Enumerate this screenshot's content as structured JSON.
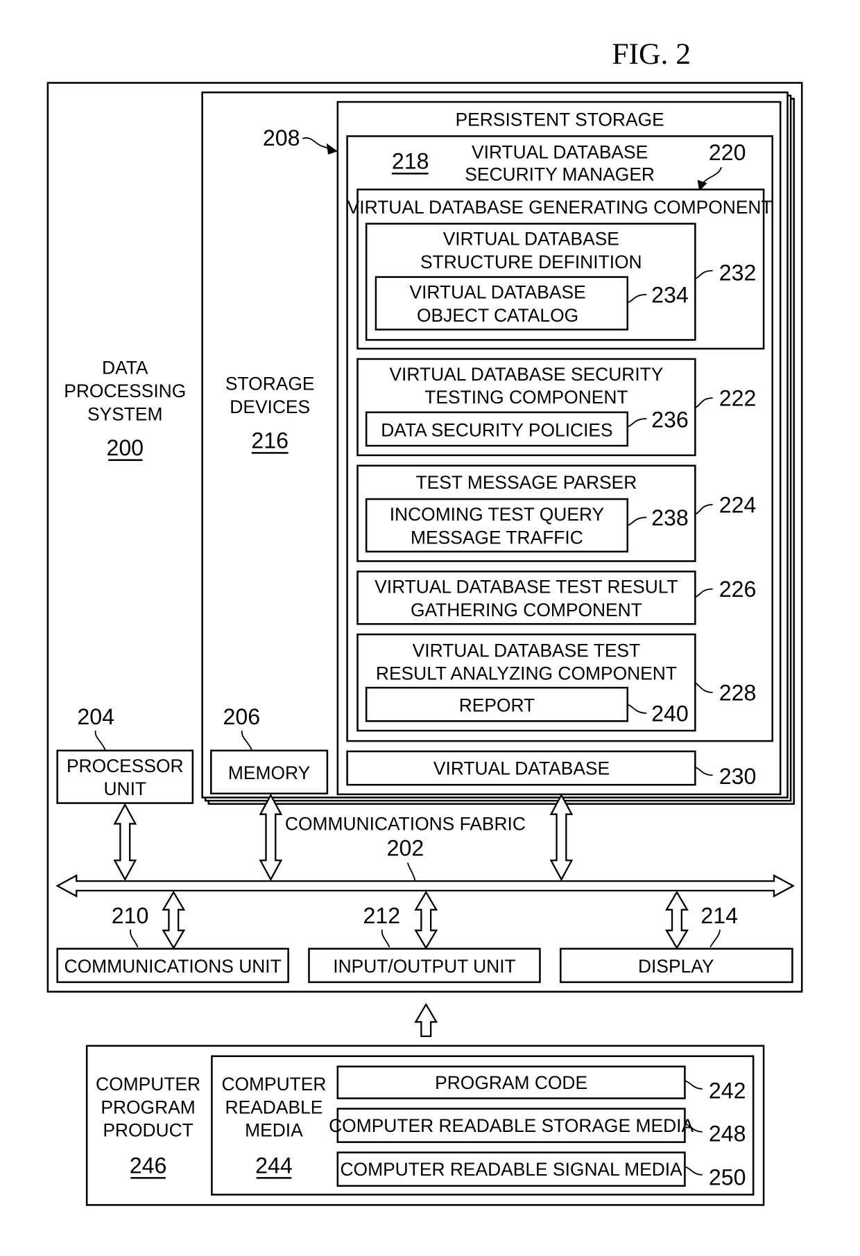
{
  "figure": {
    "title": "FIG. 2"
  },
  "data_processing_system": {
    "label_lines": [
      "DATA",
      "PROCESSING",
      "SYSTEM"
    ],
    "ref": "200"
  },
  "storage_devices": {
    "label_lines": [
      "STORAGE",
      "DEVICES"
    ],
    "ref": "216"
  },
  "persistent_storage": {
    "label": "PERSISTENT STORAGE",
    "ref": "208"
  },
  "security_manager": {
    "label_lines": [
      "VIRTUAL DATABASE",
      "SECURITY MANAGER"
    ],
    "ref": "218"
  },
  "generating_component": {
    "label": "VIRTUAL DATABASE GENERATING COMPONENT",
    "ref": "220"
  },
  "structure_definition": {
    "label_lines": [
      "VIRTUAL DATABASE",
      "STRUCTURE DEFINITION"
    ],
    "ref": "232"
  },
  "object_catalog": {
    "label_lines": [
      "VIRTUAL DATABASE",
      "OBJECT CATALOG"
    ],
    "ref": "234"
  },
  "security_testing": {
    "label_lines": [
      "VIRTUAL DATABASE SECURITY",
      "TESTING COMPONENT"
    ],
    "ref": "222"
  },
  "security_policies": {
    "label": "DATA SECURITY POLICIES",
    "ref": "236"
  },
  "message_parser": {
    "label": "TEST MESSAGE PARSER",
    "ref": "224"
  },
  "query_traffic": {
    "label_lines": [
      "INCOMING TEST QUERY",
      "MESSAGE TRAFFIC"
    ],
    "ref": "238"
  },
  "result_gathering": {
    "label_lines": [
      "VIRTUAL DATABASE TEST RESULT",
      "GATHERING COMPONENT"
    ],
    "ref": "226"
  },
  "result_analyzing": {
    "label_lines": [
      "VIRTUAL DATABASE TEST",
      "RESULT ANALYZING COMPONENT"
    ],
    "ref": "228"
  },
  "report": {
    "label": "REPORT",
    "ref": "240"
  },
  "virtual_database": {
    "label": "VIRTUAL DATABASE",
    "ref": "230"
  },
  "processor_unit": {
    "label_lines": [
      "PROCESSOR",
      "UNIT"
    ],
    "ref": "204"
  },
  "memory": {
    "label": "MEMORY",
    "ref": "206"
  },
  "communications_fabric": {
    "label": "COMMUNICATIONS FABRIC",
    "ref": "202"
  },
  "communications_unit": {
    "label": "COMMUNICATIONS UNIT",
    "ref": "210"
  },
  "io_unit": {
    "label": "INPUT/OUTPUT UNIT",
    "ref": "212"
  },
  "display": {
    "label": "DISPLAY",
    "ref": "214"
  },
  "program_product": {
    "label_lines": [
      "COMPUTER",
      "PROGRAM",
      "PRODUCT"
    ],
    "ref": "246"
  },
  "readable_media": {
    "label_lines": [
      "COMPUTER",
      "READABLE",
      "MEDIA"
    ],
    "ref": "244"
  },
  "program_code": {
    "label": "PROGRAM CODE",
    "ref": "242"
  },
  "storage_media": {
    "label": "COMPUTER READABLE STORAGE MEDIA",
    "ref": "248"
  },
  "signal_media": {
    "label": "COMPUTER READABLE SIGNAL MEDIA",
    "ref": "250"
  }
}
